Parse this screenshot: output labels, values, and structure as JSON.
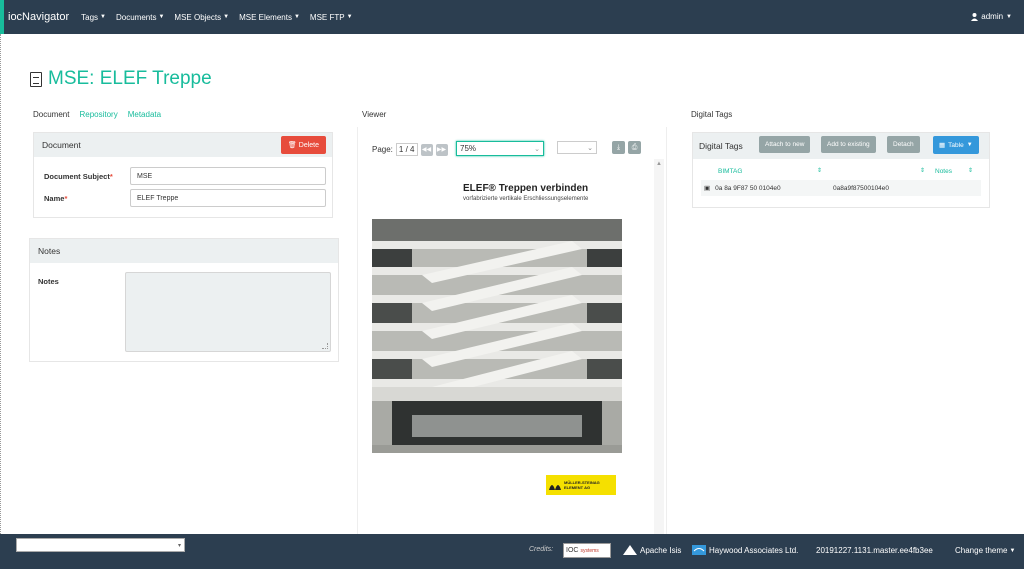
{
  "nav": {
    "brand": "iocNavigator",
    "menus": [
      "Tags",
      "Documents",
      "MSE Objects",
      "MSE Elements",
      "MSE FTP"
    ],
    "user": "admin"
  },
  "page": {
    "title": "MSE: ELEF Treppe"
  },
  "tabs": [
    "Document",
    "Repository",
    "Metadata"
  ],
  "document_panel": {
    "header": "Document",
    "delete_label": "Delete",
    "fields": [
      {
        "label": "Document Subject",
        "value": "MSE"
      },
      {
        "label": "Name",
        "value": "ELEF Treppe"
      }
    ]
  },
  "notes_panel": {
    "header": "Notes",
    "label": "Notes",
    "value": ""
  },
  "viewer": {
    "label": "Viewer",
    "page_label": "Page:",
    "page_current": "1",
    "page_total": "/ 4",
    "zoom": "75%",
    "doc_title": "ELEF® Treppen verbinden",
    "doc_subtitle": "vorfabrizierte vertikale Erschliessungselemente",
    "logo_text_1": "MÜLLER-STEINAG",
    "logo_text_2": "ELEMENT AG"
  },
  "digital_tags": {
    "section_label": "Digital Tags",
    "header": "Digital Tags",
    "buttons": [
      "Attach to new",
      "Add to existing",
      "Detach"
    ],
    "table_button": "Table",
    "columns": [
      "BIMTAG",
      "Notes"
    ],
    "rows": [
      {
        "tag": "0a 8a 9F87 50 0104e0",
        "id": "0a8a9f87500104e0"
      }
    ]
  },
  "footer": {
    "credits_label": "Credits:",
    "ioc_credit": "IOC",
    "ioc_credit_small": "systems",
    "isis_credit": "Apache Isis",
    "haywood_credit": "Haywood Associates Ltd.",
    "version": "20191227.1131.master.ee4fb3ee",
    "change_theme": "Change theme"
  },
  "colors": {
    "accent": "#18bc9c",
    "navbar": "#2c3e50",
    "danger": "#e74c3c",
    "primary": "#3498db"
  }
}
